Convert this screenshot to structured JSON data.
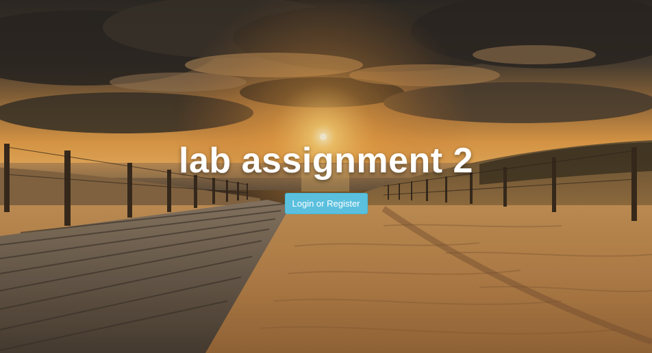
{
  "hero": {
    "title": "lab assignment 2",
    "button_label": "Login or Register",
    "background": {
      "scene": "sunset beach with wooden boardwalk",
      "sky_color": "#3a342c",
      "sun_color": "#ffd27a",
      "horizon_color": "#e89a3c",
      "sand_color": "#c58d4e",
      "boardwalk_color": "#7a6a58"
    }
  },
  "colors": {
    "button_background": "#5bc0de",
    "button_border": "#46b8da",
    "title_text": "#ffffff"
  }
}
